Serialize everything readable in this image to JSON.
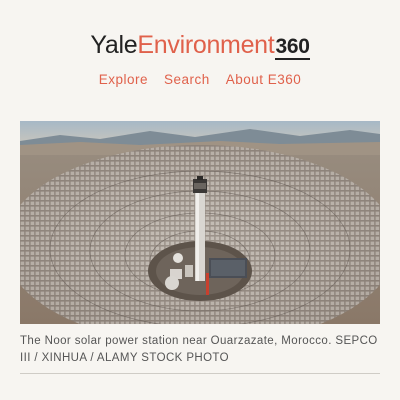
{
  "header": {
    "logo": {
      "part1": "Yale",
      "part2": "Environment",
      "part3": "360"
    },
    "nav": [
      {
        "label": "Explore"
      },
      {
        "label": "Search"
      },
      {
        "label": "About E360"
      }
    ]
  },
  "feature": {
    "image_subject": "aerial view of a concentric field of solar mirrors around a central tower in a desert valley",
    "caption": "The Noor solar power station near Ouarzazate, Morocco. SEPCO III / XINHUA / ALAMY STOCK PHOTO"
  },
  "colors": {
    "brand_accent": "#e0614b",
    "text_dark": "#222222",
    "background": "#f7f5f1"
  }
}
